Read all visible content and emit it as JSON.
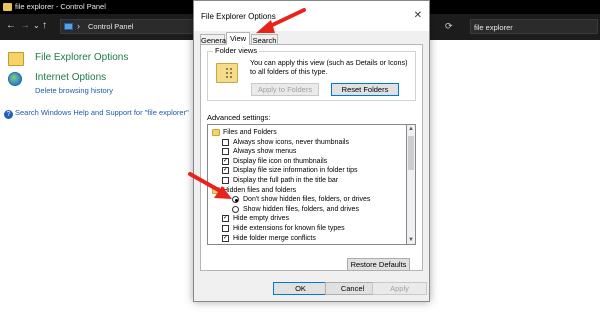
{
  "window": {
    "title": "file explorer - Control Panel"
  },
  "address_bar": {
    "path": "Control Panel",
    "search_value": "file explorer"
  },
  "results": [
    {
      "title": "File Explorer Options",
      "subtitle": ""
    },
    {
      "title": "Internet Options",
      "subtitle": "Delete browsing history"
    }
  ],
  "help_link": "Search Windows Help and Support for \"file explorer\"",
  "dialog": {
    "title": "File Explorer Options",
    "close_glyph": "✕",
    "tabs": [
      {
        "label": "General"
      },
      {
        "label": "View"
      },
      {
        "label": "Search"
      }
    ],
    "active_tab": "View",
    "folder_views": {
      "legend": "Folder views",
      "description": "You can apply this view (such as Details or Icons) to all folders of this type.",
      "apply_button": "Apply to Folders",
      "reset_button": "Reset Folders"
    },
    "advanced_label": "Advanced settings:",
    "advanced_items": [
      {
        "type": "folder",
        "label": "Files and Folders",
        "checked": false
      },
      {
        "type": "checkbox",
        "label": "Always show icons, never thumbnails",
        "checked": false
      },
      {
        "type": "checkbox",
        "label": "Always show menus",
        "checked": false
      },
      {
        "type": "checkbox",
        "label": "Display file icon on thumbnails",
        "checked": true
      },
      {
        "type": "checkbox",
        "label": "Display file size information in folder tips",
        "checked": true
      },
      {
        "type": "checkbox",
        "label": "Display the full path in the title bar",
        "checked": false
      },
      {
        "type": "folder",
        "label": "Hidden files and folders",
        "checked": false
      },
      {
        "type": "radio",
        "label": "Don't show hidden files, folders, or drives",
        "checked": true
      },
      {
        "type": "radio",
        "label": "Show hidden files, folders, and drives",
        "checked": false
      },
      {
        "type": "checkbox",
        "label": "Hide empty drives",
        "checked": true
      },
      {
        "type": "checkbox",
        "label": "Hide extensions for known file types",
        "checked": false
      },
      {
        "type": "checkbox",
        "label": "Hide folder merge conflicts",
        "checked": true
      }
    ],
    "restore_button": "Restore Defaults",
    "ok_button": "OK",
    "cancel_button": "Cancel",
    "apply_button": "Apply"
  },
  "annotation_color": "#e8231c"
}
